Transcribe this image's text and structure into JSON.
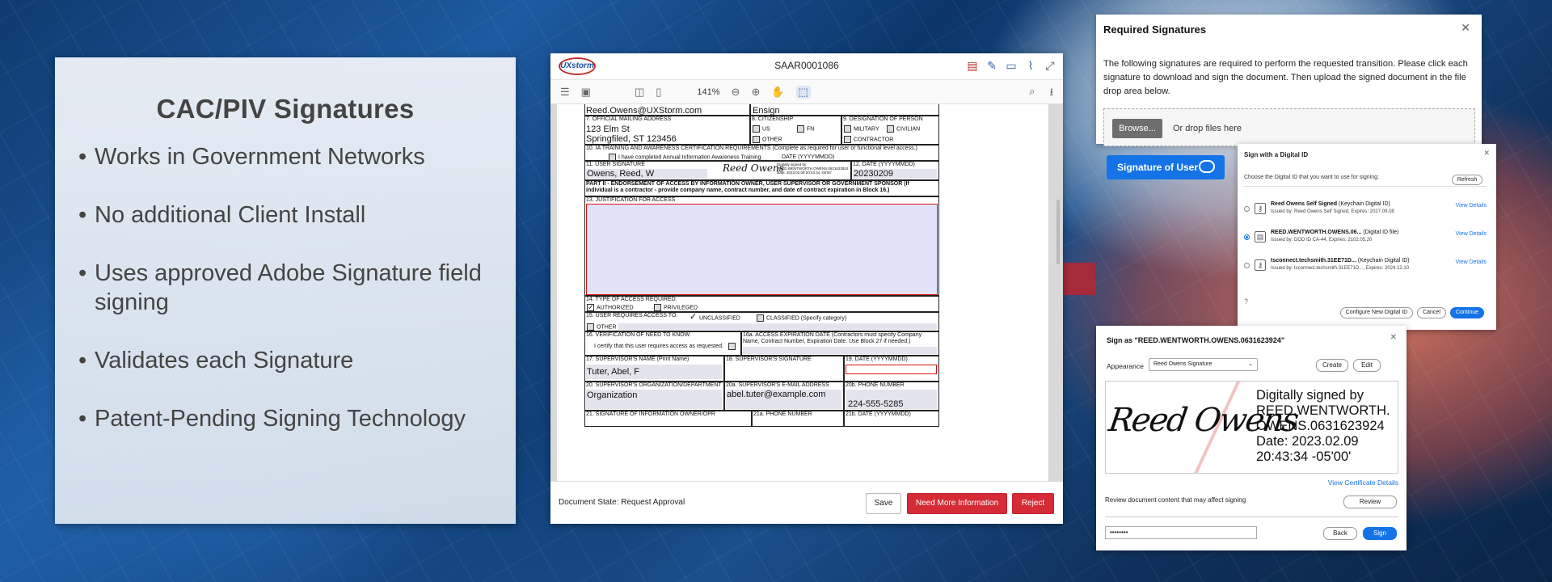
{
  "slide": {
    "title": "CAC/PIV Signatures",
    "bullets": [
      "Works in Government Networks",
      "No additional Client Install",
      "Uses approved Adobe Signature field signing",
      "Validates each Signature",
      "Patent-Pending Signing Technology"
    ]
  },
  "pdf_viewer": {
    "logo": "UXstorm",
    "document_title": "SAAR0001086",
    "zoom": "141%",
    "form": {
      "official_email_value": "Reed.Owens@UXStorm.com",
      "rank_value": "Ensign",
      "mailing_address_label": "7.  OFFICIAL MAILING ADDRESS",
      "mailing_address_line1": "123 Elm St",
      "mailing_address_line2": "Springfiled, ST 123456",
      "citizenship_label": "8.  CITIZENSHIP",
      "citizenship_us": "US",
      "citizenship_fn": "FN",
      "citizenship_other": "OTHER",
      "designation_label": "9.  DESIGNATION OF PERSON",
      "designation_military": "MILITARY",
      "designation_civilian": "CIVILIAN",
      "designation_contractor": "CONTRACTOR",
      "ia_training_label": "10. IA TRAINING AND AWARENESS CERTIFICATION REQUIREMENTS (Complete as required for user or functional level access.)",
      "ia_training_check": "I have completed Annual Information Awareness Training.",
      "ia_date_label": "DATE (YYYYMMDD)",
      "user_signature_label": "11. USER SIGNATURE",
      "user_signature_name": "Owens, Reed, W",
      "digital_sig_note": "Digitally signed by REED.WENTWORTH.OWENS.0631623924 Date: 2023.02.09 20:43:34 -05'00'",
      "date_label": "12.  DATE (YYYYMMDD)",
      "date_value": "20230209",
      "part2_label": "PART II - ENDORSEMENT OF ACCESS BY INFORMATION OWNER, USER SUPERVISOR OR GOVERNMENT SPONSOR (If individual is a contractor - provide company name, contract number, and date of contract expiration in Block 16.)",
      "justification_label": "13. JUSTIFICATION FOR ACCESS",
      "type_access_label": "14. TYPE OF ACCESS REQUIRED:",
      "authorized": "AUTHORIZED",
      "privileged": "PRIVILEGED",
      "requires_access_label": "15. USER REQUIRES ACCESS TO:",
      "unclassified": "UNCLASSIFIED",
      "classified": "CLASSIFIED (Specify category)",
      "other": "OTHER",
      "need_to_know_label": "16. VERIFICATION OF NEED TO KNOW",
      "need_to_know_text": "I certify that this user requires access as requested.",
      "expiration_label": "16a. ACCESS EXPIRATION DATE (Contractors must specify Company Name, Contract Number, Expiration Date.  Use Block 27 if needed.)",
      "supervisor_name_label": "17. SUPERVISOR'S NAME (Print Name)",
      "supervisor_name_value": "Tuter, Abel, F",
      "supervisor_signature_label": "18. SUPERVISOR'S SIGNATURE",
      "date19_label": "19. DATE (YYYYMMDD)",
      "supervisor_org_label": "20.  SUPERVISOR'S ORGANIZATION/DEPARTMENT",
      "supervisor_org_value": "Organization",
      "supervisor_email_label": "20a. SUPERVISOR'S E-MAIL ADDRESS",
      "supervisor_email_value": "abel.tuter@example.com",
      "phone_label": "20b. PHONE NUMBER",
      "phone_value": "224-555-5285",
      "info_owner_label": "21. SIGNATURE OF INFORMATION OWNER/OPR",
      "phone21a_label": "21a. PHONE NUMBER",
      "date21b_label": "21b. DATE (YYYYMMDD)"
    },
    "footer": {
      "state": "Document State: Request Approval",
      "save": "Save",
      "need_info": "Need More Information",
      "reject": "Reject"
    }
  },
  "required_signatures": {
    "title": "Required Signatures",
    "description": "The following signatures are required to perform the requested transition. Please click each signature to download and sign the document. Then upload the signed document in the file drop area below.",
    "browse": "Browse...",
    "drop_hint": "Or drop files here",
    "signature_button": "Signature of User"
  },
  "digital_id_dialog": {
    "title": "Sign with a Digital ID",
    "subtitle": "Choose the Digital ID that you want to use for signing:",
    "refresh": "Refresh",
    "ids": [
      {
        "name": "Reed Owens Self Signed",
        "type": "(Keychain Digital ID)",
        "issuer": "Issued by: Reed Owens Self Signed, Expires: 2027.09.08",
        "link": "View Details"
      },
      {
        "name": "REED.WENTWORTH.OWENS.06...",
        "type": "(Digital ID file)",
        "issuer": "Issued by: DOD ID CA-44, Expires: 2102.05.20",
        "link": "View Details"
      },
      {
        "name": "tsconnect.techsmith.31EE71D...",
        "type": "(Keychain Digital ID)",
        "issuer": "Issued by: tsconnect.techsmith.31EE71D..., Expires: 2024.12.10",
        "link": "View Details"
      }
    ],
    "configure": "Configure New Digital ID",
    "cancel": "Cancel",
    "continue": "Continue"
  },
  "sign_as_dialog": {
    "title": "Sign as \"REED.WENTWORTH.OWENS.0631623924\"",
    "appearance_label": "Appearance",
    "appearance_value": "Reed Owens Signature",
    "create": "Create",
    "edit": "Edit",
    "signature_script": "Reed Owens",
    "signature_text": "Digitally signed by\nREED.WENTWORTH.\nOWENS.0631623924\nDate: 2023.02.09\n20:43:34 -05'00'",
    "view_certificate": "View Certificate Details",
    "review_text": "Review document content that may affect signing",
    "review": "Review",
    "password_mask": "••••••••",
    "back": "Back",
    "sign": "Sign"
  }
}
